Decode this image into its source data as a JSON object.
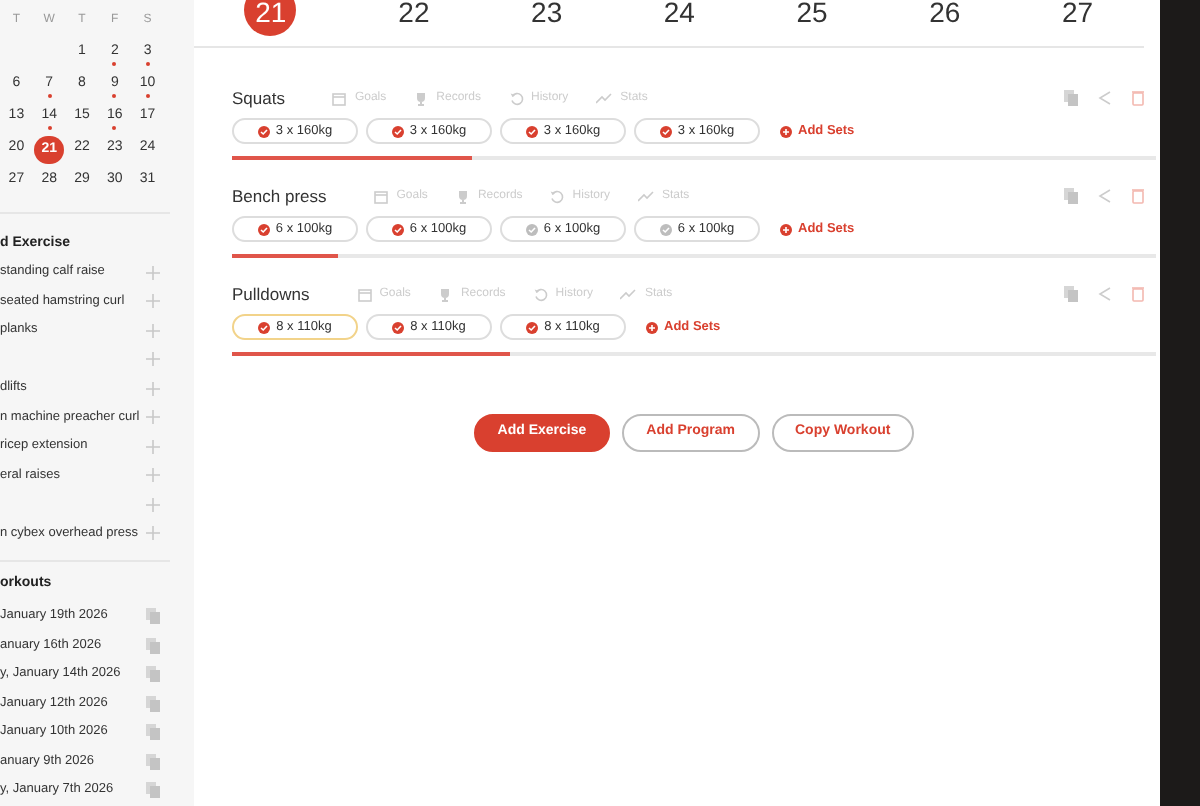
{
  "calendar": {
    "weekdays": [
      "T",
      "W",
      "T",
      "F",
      "S"
    ],
    "rows": [
      [
        null,
        null,
        {
          "day": "1",
          "dot": false,
          "selected": false
        },
        {
          "day": "2",
          "dot": true,
          "selected": false
        },
        {
          "day": "3",
          "dot": true,
          "selected": false
        }
      ],
      [
        {
          "day": "6",
          "dot": false,
          "selected": false
        },
        {
          "day": "7",
          "dot": true,
          "selected": false
        },
        {
          "day": "8",
          "dot": false,
          "selected": false
        },
        {
          "day": "9",
          "dot": true,
          "selected": false
        },
        {
          "day": "10",
          "dot": true,
          "selected": false
        }
      ],
      [
        {
          "day": "13",
          "dot": false,
          "selected": false
        },
        {
          "day": "14",
          "dot": true,
          "selected": false
        },
        {
          "day": "15",
          "dot": false,
          "selected": false
        },
        {
          "day": "16",
          "dot": true,
          "selected": false
        },
        {
          "day": "17",
          "dot": false,
          "selected": false
        }
      ],
      [
        {
          "day": "20",
          "dot": false,
          "selected": false
        },
        {
          "day": "21",
          "dot": false,
          "selected": true
        },
        {
          "day": "22",
          "dot": false,
          "selected": false
        },
        {
          "day": "23",
          "dot": false,
          "selected": false
        },
        {
          "day": "24",
          "dot": false,
          "selected": false
        }
      ],
      [
        {
          "day": "27",
          "dot": false,
          "selected": false
        },
        {
          "day": "28",
          "dot": false,
          "selected": false
        },
        {
          "day": "29",
          "dot": false,
          "selected": false
        },
        {
          "day": "30",
          "dot": false,
          "selected": false
        },
        {
          "day": "31",
          "dot": false,
          "selected": false
        }
      ]
    ]
  },
  "exercise_list": {
    "title": "d Exercise",
    "items": [
      {
        "kind": "named",
        "label": "standing calf raise"
      },
      {
        "kind": "named",
        "label": "seated hamstring curl"
      },
      {
        "kind": "named",
        "label": "planks"
      },
      {
        "kind": "blank"
      },
      {
        "kind": "named",
        "label": "dlifts"
      },
      {
        "kind": "named",
        "label": "n machine preacher curl"
      },
      {
        "kind": "named",
        "label": "ricep extension"
      },
      {
        "kind": "named",
        "label": "eral raises"
      },
      {
        "kind": "blank"
      },
      {
        "kind": "named",
        "label": "n cybex overhead press"
      }
    ]
  },
  "workouts": {
    "title": "orkouts",
    "items": [
      "January 19th 2026",
      "anuary 16th 2026",
      "y, January 14th 2026",
      "January 12th 2026",
      "January 10th 2026",
      "anuary 9th 2026",
      "y, January 7th 2026"
    ]
  },
  "week": [
    {
      "day": "21",
      "selected": true
    },
    {
      "day": "22",
      "selected": false
    },
    {
      "day": "23",
      "selected": false
    },
    {
      "day": "24",
      "selected": false
    },
    {
      "day": "25",
      "selected": false
    },
    {
      "day": "26",
      "selected": false
    },
    {
      "day": "27",
      "selected": false
    }
  ],
  "exercises": [
    {
      "name": "Squats",
      "tools": [
        "Goals",
        "Records",
        "History",
        "Stats"
      ],
      "level": 0.26,
      "add_label": "Add Sets",
      "sets": [
        {
          "label": "3 x 160kg",
          "done": true,
          "selected": false
        },
        {
          "label": "3 x 160kg",
          "done": true,
          "selected": false
        },
        {
          "label": "3 x 160kg",
          "done": true,
          "selected": false
        },
        {
          "label": "3 x 160kg",
          "done": true,
          "selected": false
        }
      ]
    },
    {
      "name": "Bench press",
      "tools": [
        "Goals",
        "Records",
        "History",
        "Stats"
      ],
      "level": 0.115,
      "add_label": "Add Sets",
      "sets": [
        {
          "label": "6 x 100kg",
          "done": true,
          "selected": false
        },
        {
          "label": "6 x 100kg",
          "done": true,
          "selected": false
        },
        {
          "label": "6 x 100kg",
          "done": false,
          "selected": false
        },
        {
          "label": "6 x 100kg",
          "done": false,
          "selected": false
        }
      ]
    },
    {
      "name": "Pulldowns",
      "tools": [
        "Goals",
        "Records",
        "History",
        "Stats"
      ],
      "level": 0.3,
      "add_label": "Add Sets",
      "sets": [
        {
          "label": "8 x 110kg",
          "done": true,
          "selected": true
        },
        {
          "label": "8 x 110kg",
          "done": true,
          "selected": false
        },
        {
          "label": "8 x 110kg",
          "done": true,
          "selected": false
        }
      ]
    }
  ],
  "buttons": [
    {
      "label": "Add Exercise",
      "kind": "primary"
    },
    {
      "label": "Add Program",
      "kind": "outline"
    },
    {
      "label": "Copy Workout",
      "kind": "outline"
    }
  ]
}
